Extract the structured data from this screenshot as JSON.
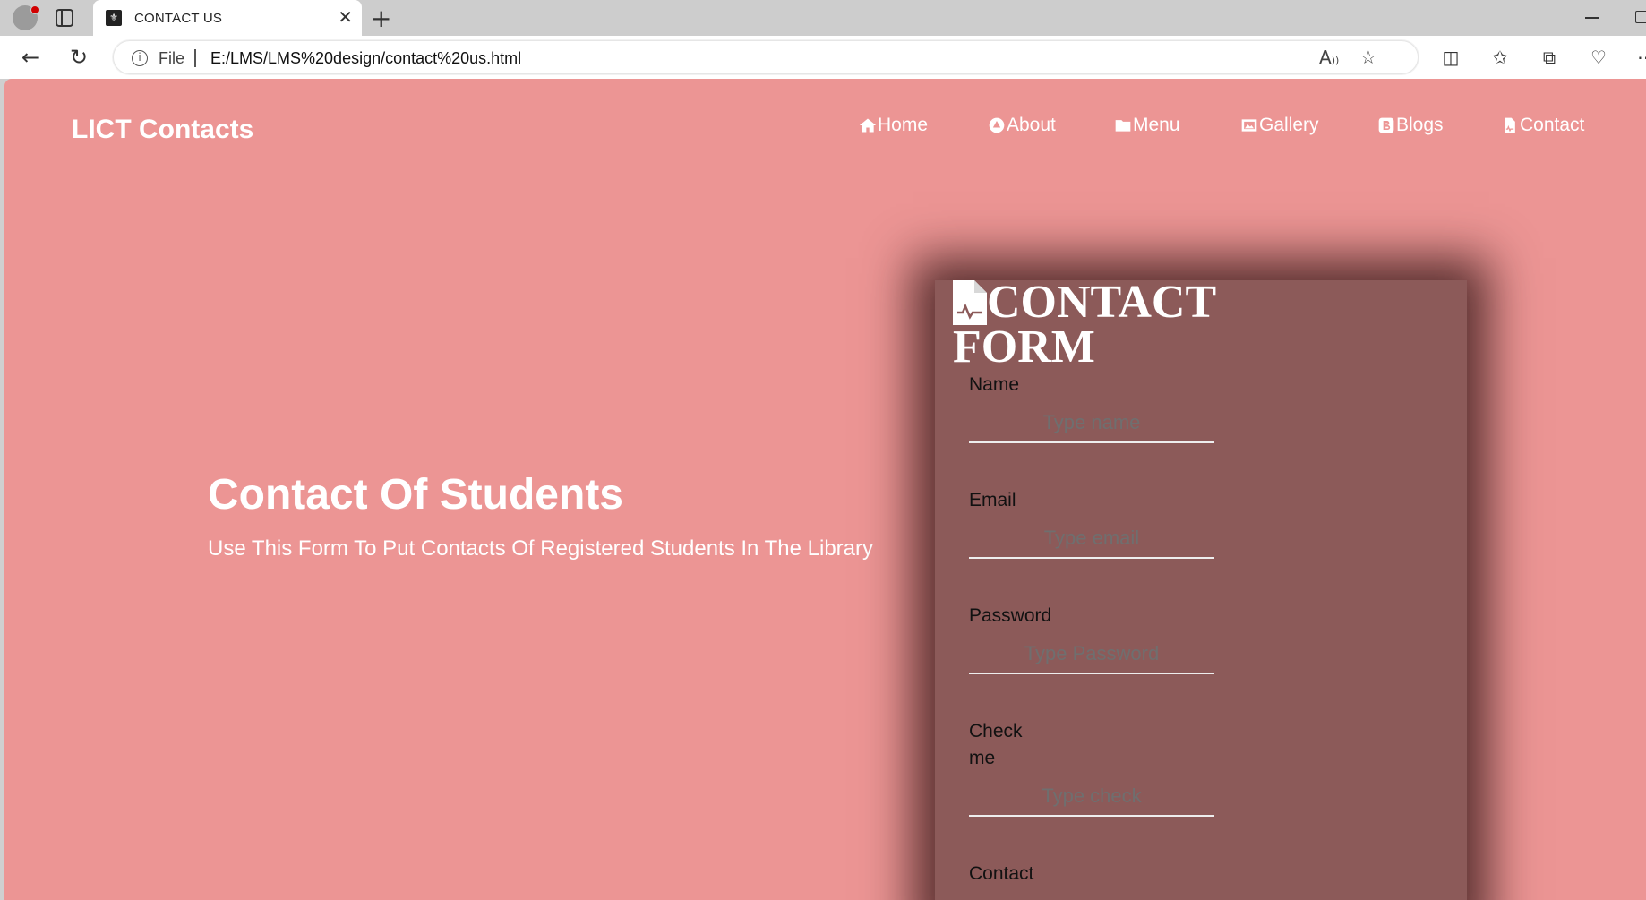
{
  "browser": {
    "tab_title": "CONTACT US",
    "tab_favicon": "library-logo-icon",
    "address_scheme": "File",
    "address_url": "E:/LMS/LMS%20design/contact%20us.html"
  },
  "page": {
    "brand": "LICT Contacts",
    "nav": [
      {
        "label": "Home",
        "icon": "home-icon"
      },
      {
        "label": "About",
        "icon": "about-icon"
      },
      {
        "label": "Menu",
        "icon": "folder-icon"
      },
      {
        "label": "Gallery",
        "icon": "image-icon"
      },
      {
        "label": "Blogs",
        "icon": "blog-icon"
      },
      {
        "label": "Contact",
        "icon": "document-icon"
      }
    ],
    "hero": {
      "title": "Contact Of Students",
      "subtitle": "Use This Form To Put Contacts Of Registered Students In The Library"
    },
    "form": {
      "title_line1": "CONTACT",
      "title_line2": "FORM",
      "fields": [
        {
          "label": "Name",
          "placeholder": "Type name"
        },
        {
          "label": "Email",
          "placeholder": "Type email"
        },
        {
          "label": "Password",
          "placeholder": "Type Password"
        },
        {
          "label": "Check me",
          "placeholder": "Type check"
        },
        {
          "label": "Contact",
          "placeholder": ""
        }
      ]
    }
  }
}
